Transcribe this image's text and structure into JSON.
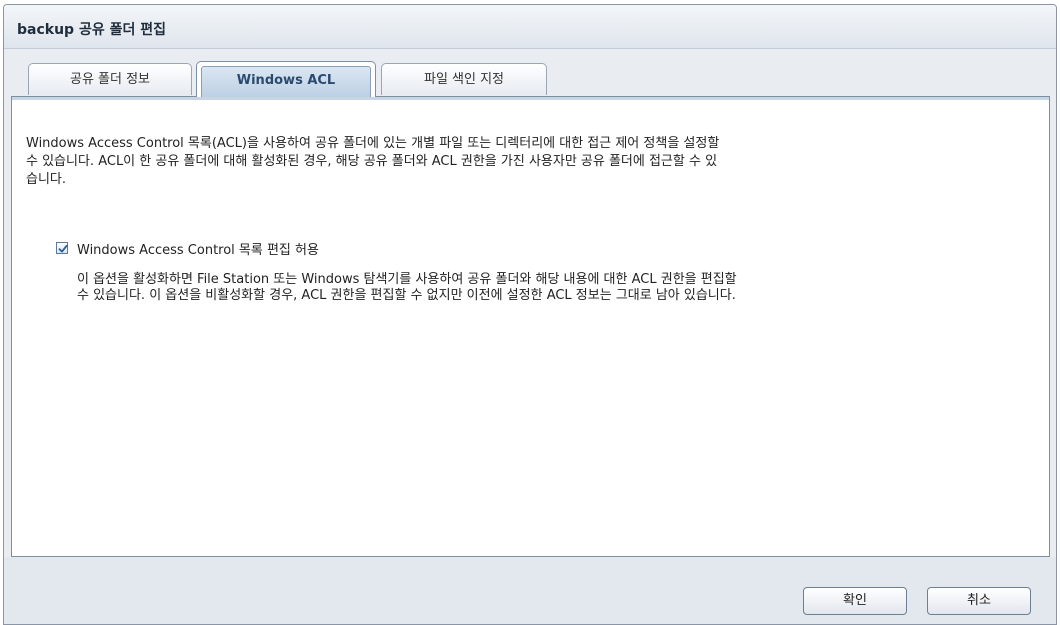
{
  "dialog": {
    "title": "backup 공유 폴더 편집"
  },
  "tabs": [
    {
      "label": "공유 폴더 정보",
      "active": false
    },
    {
      "label": "Windows ACL",
      "active": true
    },
    {
      "label": "파일 색인 지정",
      "active": false
    }
  ],
  "acl": {
    "description_lines": [
      "Windows Access Control 목록(ACL)을 사용하여 공유 폴더에 있는 개별 파일 또는 디렉터리에 대한 접근 제어 정책을 설정할",
      "수 있습니다. ACL이 한 공유 폴더에 대해 활성화된 경우, 해당 공유 폴더와 ACL 권한을 가진 사용자만 공유 폴더에 접근할 수 있",
      "습니다."
    ],
    "checkbox": {
      "label": "Windows Access Control 목록 편집 허용",
      "checked": true
    },
    "option_description_lines": [
      "이 옵션을 활성화하면 File Station 또는 Windows 탐색기를 사용하여 공유 폴더와 해당 내용에 대한 ACL 권한을 편집할",
      "수 있습니다. 이 옵션을 비활성화할 경우, ACL 권한을 편집할 수 없지만 이전에 설정한 ACL 정보는 그대로 남아 있습니다."
    ]
  },
  "footer": {
    "ok_label": "확인",
    "cancel_label": "취소"
  },
  "colors": {
    "accent": "#2a4a6e",
    "checkmark": "#2b5e99"
  }
}
